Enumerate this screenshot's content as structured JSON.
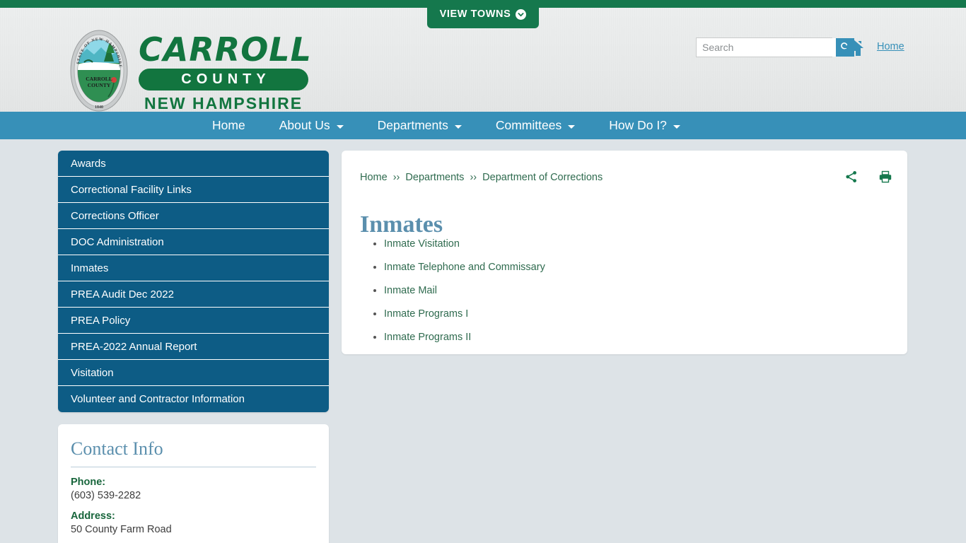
{
  "topbar": {
    "view_towns_label": "VIEW TOWNS",
    "chevron_icon": "chevron-down-circle-icon",
    "green": "#15784d"
  },
  "header": {
    "seal": {
      "outer_text": "STATE OF NEW HAMPSHIRE",
      "county_line1": "CARROLL",
      "county_line2": "COUNTY",
      "year": "1840"
    },
    "wordmark": {
      "line1": "CARROLL",
      "line2": "COUNTY",
      "line3": "NEW HAMPSHIRE",
      "green": "#12753f"
    },
    "search": {
      "placeholder": "Search",
      "value": "",
      "button_icon": "search-icon"
    },
    "home_icon": "home-icon",
    "home_link": "Home"
  },
  "nav": {
    "accent": "#3790b8",
    "items": [
      {
        "label": "Home",
        "has_caret": false
      },
      {
        "label": "About Us",
        "has_caret": true
      },
      {
        "label": "Departments",
        "has_caret": true
      },
      {
        "label": "Committees",
        "has_caret": true
      },
      {
        "label": "How Do I?",
        "has_caret": true
      }
    ]
  },
  "sidebar": {
    "accent": "#0d5c85",
    "items": [
      {
        "label": "Awards"
      },
      {
        "label": "Correctional Facility Links"
      },
      {
        "label": "Corrections Officer"
      },
      {
        "label": "DOC Administration"
      },
      {
        "label": "Inmates"
      },
      {
        "label": "PREA Audit Dec 2022"
      },
      {
        "label": "PREA Policy"
      },
      {
        "label": "PREA-2022 Annual Report"
      },
      {
        "label": "Visitation"
      },
      {
        "label": "Volunteer and Contractor Information"
      }
    ]
  },
  "contact": {
    "heading": "Contact Info",
    "phone_label": "Phone:",
    "phone_value": "(603) 539-2282",
    "address_label": "Address:",
    "address_value": "50 County Farm Road"
  },
  "main": {
    "breadcrumb": [
      {
        "label": "Home"
      },
      {
        "label": "Departments"
      },
      {
        "label": "Department of Corrections"
      }
    ],
    "breadcrumb_separator": "››",
    "title": "Inmates",
    "actions": [
      {
        "icon": "share-icon"
      },
      {
        "icon": "print-icon"
      }
    ],
    "links": [
      {
        "label": "Inmate Visitation"
      },
      {
        "label": "Inmate Telephone and Commissary"
      },
      {
        "label": "Inmate Mail"
      },
      {
        "label": "Inmate Programs I"
      },
      {
        "label": "Inmate Programs II"
      }
    ],
    "title_color": "#5b8fad",
    "link_color": "#2f6b4f"
  }
}
